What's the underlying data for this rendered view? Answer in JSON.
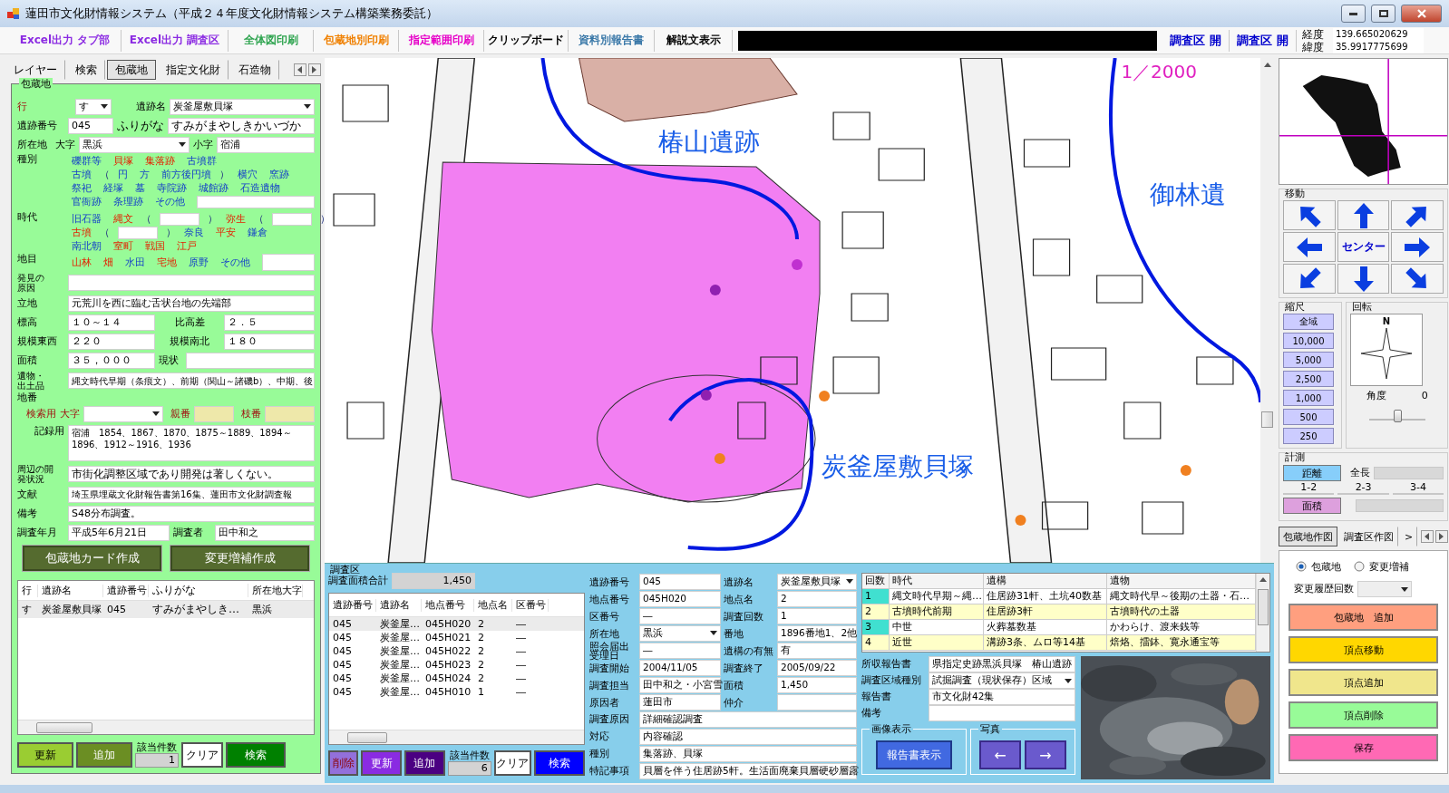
{
  "window": {
    "title": "蓮田市文化財情報システム（平成２４年度文化財情報システム構築業務委託）"
  },
  "toolbar": {
    "buttons": [
      {
        "label": "Excel出力 タブ部",
        "color": "#8b2be2"
      },
      {
        "label": "Excel出力 調査区",
        "color": "#8b2be2"
      },
      {
        "label": "全体図印刷",
        "color": "#2ea44f"
      },
      {
        "label": "包蔵地別印刷",
        "color": "#f08000"
      },
      {
        "label": "指定範囲印刷",
        "color": "#e600c8"
      },
      {
        "label": "クリップボード",
        "color": "#000000"
      },
      {
        "label": "資料別報告書",
        "color": "#3a78a8"
      },
      {
        "label": "解説文表示",
        "color": "#000000"
      }
    ],
    "open_buttons": [
      {
        "label": "調査区 開"
      },
      {
        "label": "調査区 開"
      }
    ],
    "coords": [
      {
        "label": "経度",
        "value": "139.665020629"
      },
      {
        "label": "緯度",
        "value": "35.9917775699"
      }
    ]
  },
  "left_tabs": [
    {
      "label": "レイヤー",
      "selected": false
    },
    {
      "label": "検索",
      "selected": false
    },
    {
      "label": "包蔵地",
      "selected": true
    },
    {
      "label": "指定文化財",
      "selected": false
    },
    {
      "label": "石造物",
      "selected": false
    }
  ],
  "site": {
    "title": "包蔵地",
    "row_select": {
      "label": "行",
      "value": "す"
    },
    "name": {
      "label": "遺跡名",
      "value": "炭釜屋敷貝塚"
    },
    "number": {
      "label": "遺跡番号",
      "value": "045"
    },
    "furigana": {
      "label": "ふりがな",
      "value": "すみがまやしきかいづか"
    },
    "location": {
      "label": "所在地",
      "oaza_label": "大字",
      "oaza": "黒浜",
      "koaza_label": "小字",
      "koaza": "宿浦"
    },
    "types": {
      "label": "種別",
      "lines": [
        {
          "items": [
            {
              "kind": "choice",
              "label": "礫群等",
              "selected": false
            },
            {
              "kind": "choice",
              "label": "貝塚",
              "selected": true
            },
            {
              "kind": "choice",
              "label": "集落跡",
              "selected": true
            },
            {
              "kind": "choice",
              "label": "古墳群",
              "selected": false
            }
          ]
        },
        {
          "items": [
            {
              "kind": "choice",
              "label": "古墳",
              "selected": false
            },
            {
              "kind": "mark",
              "label": "（"
            },
            {
              "kind": "choice",
              "label": "円",
              "selected": false
            },
            {
              "kind": "choice",
              "label": "方",
              "selected": false
            },
            {
              "kind": "choice",
              "label": "前方後円墳",
              "selected": false
            },
            {
              "kind": "mark",
              "label": "）"
            },
            {
              "kind": "choice",
              "label": "横穴",
              "selected": false
            },
            {
              "kind": "choice",
              "label": "窯跡",
              "selected": false
            }
          ]
        },
        {
          "items": [
            {
              "kind": "choice",
              "label": "祭祀",
              "selected": false
            },
            {
              "kind": "choice",
              "label": "経塚",
              "selected": false
            },
            {
              "kind": "choice",
              "label": "墓",
              "selected": false
            },
            {
              "kind": "choice",
              "label": "寺院跡",
              "selected": false
            },
            {
              "kind": "choice",
              "label": "城館跡",
              "selected": false
            },
            {
              "kind": "choice",
              "label": "石造遺物",
              "selected": false
            }
          ]
        },
        {
          "items": [
            {
              "kind": "choice",
              "label": "官衙跡",
              "selected": false
            },
            {
              "kind": "choice",
              "label": "条理跡",
              "selected": false
            },
            {
              "kind": "choice",
              "label": "その他",
              "selected": false
            },
            {
              "kind": "field"
            }
          ]
        }
      ]
    },
    "eras": {
      "label": "時代",
      "lines": [
        {
          "items": [
            {
              "kind": "choice",
              "label": "旧石器",
              "selected": false
            },
            {
              "kind": "choice",
              "label": "縄文",
              "selected": true
            },
            {
              "kind": "mark",
              "label": "（"
            },
            {
              "kind": "field"
            },
            {
              "kind": "mark",
              "label": "）"
            },
            {
              "kind": "choice",
              "label": "弥生",
              "selected": true
            },
            {
              "kind": "mark",
              "label": "（"
            },
            {
              "kind": "field"
            },
            {
              "kind": "mark",
              "label": "）"
            }
          ]
        },
        {
          "items": [
            {
              "kind": "choice",
              "label": "古墳",
              "selected": true
            },
            {
              "kind": "mark",
              "label": "（"
            },
            {
              "kind": "field"
            },
            {
              "kind": "mark",
              "label": "）"
            },
            {
              "kind": "choice",
              "label": "奈良",
              "selected": false
            },
            {
              "kind": "choice",
              "label": "平安",
              "selected": true
            },
            {
              "kind": "choice",
              "label": "鎌倉",
              "selected": false
            }
          ]
        },
        {
          "items": [
            {
              "kind": "choice",
              "label": "南北朝",
              "selected": false
            },
            {
              "kind": "choice",
              "label": "室町",
              "selected": true
            },
            {
              "kind": "choice",
              "label": "戦国",
              "selected": true
            },
            {
              "kind": "choice",
              "label": "江戸",
              "selected": true
            }
          ]
        }
      ]
    },
    "land": {
      "label": "地目",
      "lines": [
        {
          "items": [
            {
              "kind": "choice",
              "label": "山林",
              "selected": true
            },
            {
              "kind": "choice",
              "label": "畑",
              "selected": true
            },
            {
              "kind": "choice",
              "label": "水田",
              "selected": false
            },
            {
              "kind": "choice",
              "label": "宅地",
              "selected": true
            },
            {
              "kind": "choice",
              "label": "原野",
              "selected": false
            },
            {
              "kind": "choice",
              "label": "その他",
              "selected": false
            },
            {
              "kind": "field"
            }
          ]
        }
      ]
    },
    "discovery": {
      "label": "発見の原因"
    },
    "setting": {
      "label": "立地",
      "value": "元荒川を西に臨む舌状台地の先端部"
    },
    "elevation": {
      "label": "標高",
      "value": "１０～１４"
    },
    "relative_height": {
      "label": "比高差",
      "value": "２．５"
    },
    "size_ew": {
      "label": "規模東西",
      "value": "２２０"
    },
    "size_ns": {
      "label": "規模南北",
      "value": "１８０"
    },
    "area": {
      "label": "面積",
      "value": "３５，０００"
    },
    "condition": {
      "label": "現状"
    },
    "finds": {
      "label": "遺物・出土品",
      "value": "縄文時代早期（条痕文）、前期（関山～諸磯b）、中期、後"
    },
    "lot": {
      "label": "地番",
      "search_label": "検索用",
      "oaza_label": "大字",
      "parent_label": "親番",
      "branch_label": "枝番",
      "record_label": "記録用",
      "record": "宿浦　1854、1867、1870、1875～1889、1894～1896、1912～1916、1936"
    },
    "surroundings": {
      "label": "周辺の開発状況",
      "value": "市街化調整区域であり開発は著しくない。"
    },
    "literature": {
      "label": "文献",
      "value": "埼玉県埋蔵文化財報告書第16集、蓮田市文化財調査報"
    },
    "remarks": {
      "label": "備考",
      "value": "S48分布調査。"
    },
    "surveyed": {
      "label": "調査年月",
      "value": "平成5年6月21日"
    },
    "surveyor": {
      "label": "調査者",
      "value": "田中和之"
    },
    "buttons": [
      {
        "label": "包蔵地カード作成"
      },
      {
        "label": "変更増補作成"
      }
    ]
  },
  "site_table": {
    "columns": [
      "行",
      "遺跡名",
      "遺跡番号",
      "ふりがな",
      "所在地大字"
    ],
    "rows": [
      {
        "cells": [
          "す",
          "炭釜屋敷貝塚",
          "045",
          "すみがまやしき…",
          "黒浜"
        ],
        "selected": true
      }
    ]
  },
  "site_actions": {
    "update": "更新",
    "add": "追加",
    "count_label": "該当件数",
    "count": "1",
    "clear": "クリア",
    "search": "検索"
  },
  "map": {
    "scale": "1／2000",
    "labels": [
      {
        "text": "椿山遺跡"
      },
      {
        "text": "御林遺"
      },
      {
        "text": "炭釜屋敷貝塚"
      }
    ]
  },
  "survey": {
    "title": "調査区",
    "total_label": "調査面積合計",
    "total": "1,450",
    "table": {
      "columns": [
        "遺跡番号",
        "遺跡名",
        "地点番号",
        "地点名",
        "区番号"
      ],
      "rows": [
        {
          "cells": [
            "045",
            "炭釜屋…",
            "045H020",
            "2",
            "―"
          ],
          "selected": true
        },
        {
          "cells": [
            "045",
            "炭釜屋…",
            "045H021",
            "2",
            "―"
          ],
          "selected": false
        },
        {
          "cells": [
            "045",
            "炭釜屋…",
            "045H022",
            "2",
            "―"
          ],
          "selected": false
        },
        {
          "cells": [
            "045",
            "炭釜屋…",
            "045H023",
            "2",
            "―"
          ],
          "selected": false
        },
        {
          "cells": [
            "045",
            "炭釜屋…",
            "045H024",
            "2",
            "―"
          ],
          "selected": false
        },
        {
          "cells": [
            "045",
            "炭釜屋…",
            "045H010",
            "1",
            "―"
          ],
          "selected": false
        }
      ]
    },
    "actions": {
      "delete": "削除",
      "update": "更新",
      "add": "追加",
      "count_label": "該当件数",
      "count": "6",
      "clear": "クリア",
      "search": "検索"
    },
    "form": {
      "pairs": [
        [
          {
            "kind": "text",
            "label": "遺跡番号",
            "value": "045"
          },
          {
            "kind": "dropdown",
            "label": "遺跡名",
            "value": "炭釜屋敷貝塚"
          }
        ],
        [
          {
            "kind": "text",
            "label": "地点番号",
            "value": "045H020"
          },
          {
            "kind": "text",
            "label": "地点名",
            "value": "2"
          }
        ],
        [
          {
            "kind": "text",
            "label": "区番号",
            "value": "―"
          },
          {
            "kind": "text",
            "label": "調査回数",
            "value": "1"
          }
        ],
        [
          {
            "kind": "dropdown",
            "label": "所在地",
            "value": "黒浜"
          },
          {
            "kind": "text",
            "label": "番地",
            "value": "1896番地1、2他"
          }
        ],
        [
          {
            "kind": "text",
            "label": "照会届出受理日",
            "value": "―"
          },
          {
            "kind": "text",
            "label": "遺構の有無",
            "value": "有"
          }
        ],
        [
          {
            "kind": "text",
            "label": "調査開始",
            "value": "2004/11/05"
          },
          {
            "kind": "text",
            "label": "調査終了",
            "value": "2005/09/22"
          }
        ],
        [
          {
            "kind": "text",
            "label": "調査担当",
            "value": "田中和之・小宮雪"
          },
          {
            "kind": "text",
            "label": "面積",
            "value": "1,450"
          }
        ],
        [
          {
            "kind": "text",
            "label": "原因者",
            "value": "蓮田市"
          },
          {
            "kind": "text",
            "label": "仲介"
          }
        ]
      ],
      "full": [
        {
          "label": "調査原因",
          "value": "詳細確認調査"
        },
        {
          "label": "対応",
          "value": "内容確認"
        },
        {
          "label": "種別",
          "value": "集落跡、貝塚"
        },
        {
          "label": "特記事項",
          "value": "貝層を伴う住居跡5軒。生活面廃棄貝層硬砂層露"
        }
      ]
    },
    "periods": {
      "columns": [
        "回数",
        "時代",
        "遺構",
        "遺物"
      ],
      "rows": [
        [
          "1",
          "縄文時代早期～縄…",
          "住居跡31軒、土坑40数基",
          "縄文時代早～後期の土器・石…"
        ],
        [
          "2",
          "古墳時代前期",
          "住居跡3軒",
          "古墳時代の土器"
        ],
        [
          "3",
          "中世",
          "火葬墓数基",
          "かわらけ、渡来銭等"
        ],
        [
          "4",
          "近世",
          "溝跡3条、ムロ等14基",
          "焙烙、擂鉢、寛永通宝等"
        ]
      ]
    },
    "report": {
      "rows": [
        {
          "kind": "text",
          "label": "所収報告書",
          "value": "県指定史跡黒浜貝塚　椿山遺跡"
        },
        {
          "kind": "dropdown",
          "label": "調査区域種別",
          "value": "試掘調査（現状保存）区域"
        },
        {
          "kind": "text",
          "label": "報告書",
          "value": "市文化財42集"
        },
        {
          "kind": "text",
          "label": "備考"
        }
      ],
      "image_group": {
        "title": "画像表示",
        "button": "報告書表示"
      },
      "photo_group": {
        "title": "写真",
        "prev": "←",
        "next": "→"
      }
    }
  },
  "nav": {
    "pan": {
      "title": "移動",
      "center": "センター"
    },
    "scale": {
      "title": "縮尺",
      "buttons": [
        "全域",
        "10,000",
        "5,000",
        "2,500",
        "1,000",
        "500",
        "250"
      ]
    },
    "rotation": {
      "title": "回転",
      "north": "N",
      "angle_label": "角度",
      "angle": "0",
      "level": 0.5
    },
    "measure": {
      "title": "計測",
      "distance": "距離",
      "total_label": "全長",
      "segments": [
        "1-2",
        "2-3",
        "3-4"
      ],
      "area": "面積"
    }
  },
  "drawing": {
    "tabs": [
      {
        "label": "包蔵地作図",
        "selected": true
      },
      {
        "label": "調査区作図",
        "selected": false
      },
      {
        "label": ">",
        "selected": false
      }
    ],
    "radios": [
      {
        "label": "包蔵地",
        "selected": true
      },
      {
        "label": "変更増補",
        "selected": false
      }
    ],
    "history_label": "変更履歴回数",
    "buttons": [
      {
        "label": "包蔵地　追加",
        "color": "#ff9f7f"
      },
      {
        "label": "頂点移動",
        "color": "#ffd700"
      },
      {
        "label": "頂点追加",
        "color": "#f0e68c"
      },
      {
        "label": "頂点削除",
        "color": "#98fb98"
      },
      {
        "label": "保存",
        "color": "#ff69b4"
      }
    ]
  }
}
